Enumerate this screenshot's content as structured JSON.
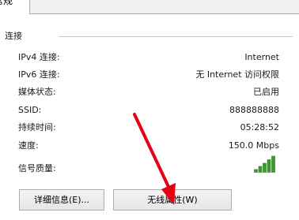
{
  "tabs": [
    {
      "label": "常规"
    }
  ],
  "connection": {
    "section_title": "连接",
    "rows": [
      {
        "label": "IPv4 连接:",
        "value": "Internet"
      },
      {
        "label": "IPv6 连接:",
        "value": "无 Internet 访问权限"
      },
      {
        "label": "媒体状态:",
        "value": "已启用"
      },
      {
        "label": "SSID:",
        "value": "888888888"
      },
      {
        "label": "持续时间:",
        "value": "05:28:52"
      },
      {
        "label": "速度:",
        "value": "150.0 Mbps"
      },
      {
        "label": "信号质量:",
        "value": null
      }
    ],
    "signal_quality": {
      "bars_lit": 5,
      "bars_total": 5,
      "icon": "signal-bars-icon",
      "color": "#3a9a2e"
    }
  },
  "buttons": {
    "details_label": "详细信息(E)...",
    "wireless_label": "无线属性(W)"
  },
  "annotation": {
    "icon": "red-arrow-icon",
    "color": "#e60012"
  }
}
